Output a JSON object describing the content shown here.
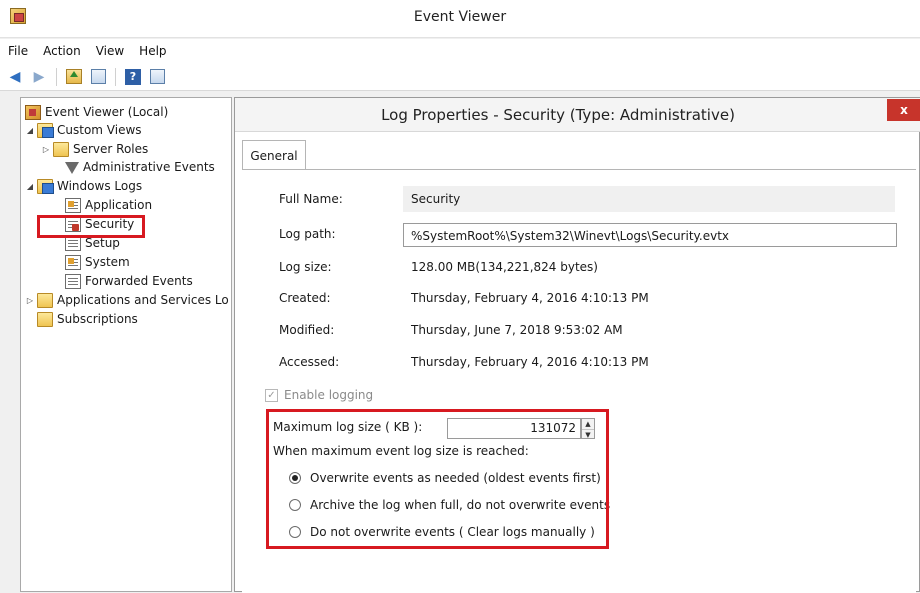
{
  "window": {
    "title": "Event Viewer"
  },
  "menu": {
    "file": "File",
    "action": "Action",
    "view": "View",
    "help": "Help"
  },
  "tree": {
    "root": "Event Viewer (Local)",
    "custom_views": "Custom Views",
    "server_roles": "Server Roles",
    "administrative_events": "Administrative Events",
    "windows_logs": "Windows Logs",
    "application": "Application",
    "security": "Security",
    "setup": "Setup",
    "system": "System",
    "forwarded_events": "Forwarded Events",
    "applications_services": "Applications and Services Lo",
    "subscriptions": "Subscriptions"
  },
  "dialog": {
    "title": "Log Properties - Security (Type: Administrative)",
    "close": "x",
    "tab_general": "General",
    "full_name_label": "Full Name:",
    "full_name_value": "Security",
    "log_path_label": "Log path:",
    "log_path_value": "%SystemRoot%\\System32\\Winevt\\Logs\\Security.evtx",
    "log_size_label": "Log size:",
    "log_size_value": "128.00 MB(134,221,824 bytes)",
    "created_label": "Created:",
    "created_value": "Thursday, February 4, 2016 4:10:13 PM",
    "modified_label": "Modified:",
    "modified_value": "Thursday, June 7, 2018 9:53:02 AM",
    "accessed_label": "Accessed:",
    "accessed_value": "Thursday, February 4, 2016 4:10:13 PM",
    "enable_logging": "Enable logging",
    "max_size_label": "Maximum log size ( KB ):",
    "max_size_value": "131072",
    "when_reached": "When maximum event log size is reached:",
    "option_overwrite": "Overwrite events as needed (oldest events first)",
    "option_archive": "Archive the log when full, do not overwrite events",
    "option_no_overwrite": "Do not overwrite events ( Clear logs manually )"
  }
}
